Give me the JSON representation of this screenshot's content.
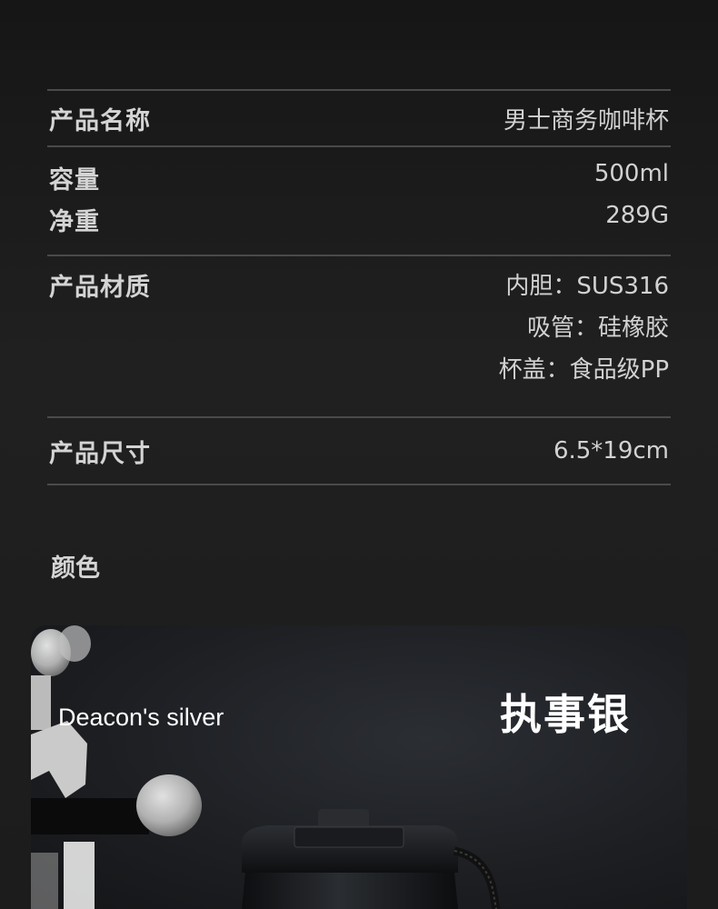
{
  "specs": {
    "name": {
      "label": "产品名称",
      "value": "男士商务咖啡杯"
    },
    "capacity": {
      "label": "容量",
      "value": "500ml"
    },
    "weight": {
      "label": "净重",
      "value": "289G"
    },
    "material": {
      "label": "产品材质",
      "values": [
        "内胆：SUS316",
        "吸管：硅橡胶",
        "杯盖：食品级PP"
      ]
    },
    "size": {
      "label": "产品尺寸",
      "value": "6.5*19cm"
    }
  },
  "color_section": {
    "title": "颜色"
  },
  "color_card": {
    "name_en": "Deacon's silver",
    "name_cn": "执事银"
  }
}
